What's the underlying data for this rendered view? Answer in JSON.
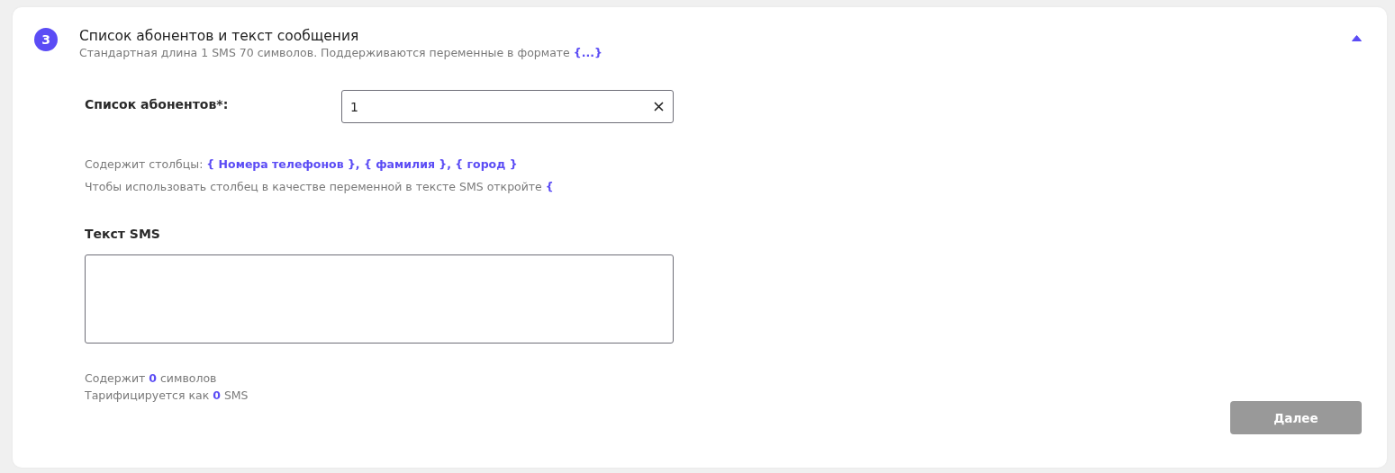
{
  "section": {
    "step": "3",
    "title": "Список абонентов и текст сообщения",
    "subtitle": "Стандартная длина 1 SMS 70 символов. Поддерживаются переменные в формате **{...}**",
    "expanded": true
  },
  "subscribers": {
    "label": "Список абонентов*:",
    "value": "1"
  },
  "hints": [
    "Содержит столбцы: **{ Номера телефонов }, { фамилия }, { город }**",
    "Чтобы использовать столбец в качестве переменной в тексте SMS откройте **{**"
  ],
  "sms": {
    "label": "Текст SMS"
  },
  "counters": [
    "Содержит **0** символов",
    "Тарифицируется как **0** SMS"
  ],
  "next_button": {
    "label": "Далее",
    "disabled": true
  }
}
